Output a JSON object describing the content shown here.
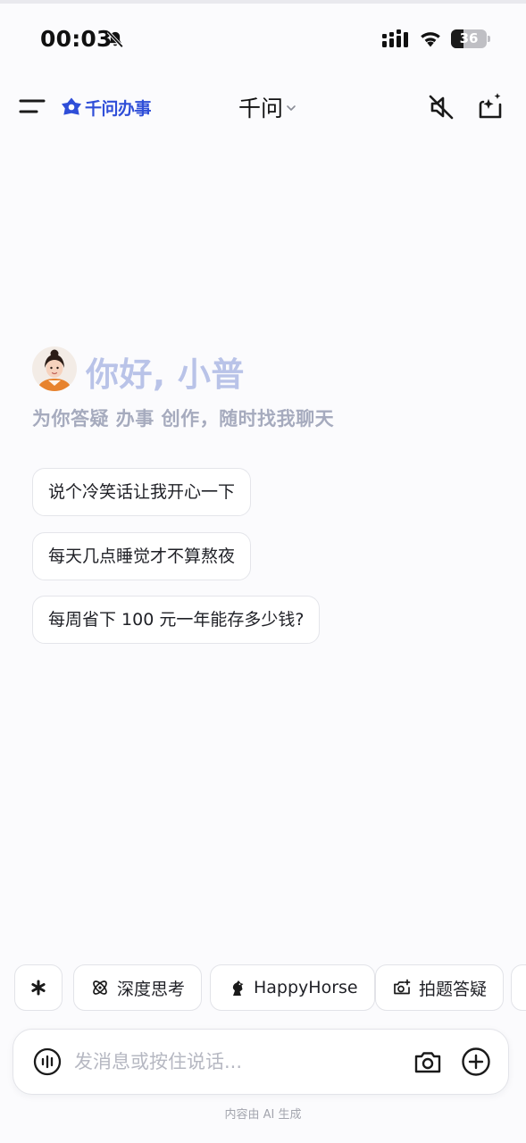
{
  "status_bar": {
    "time": "00:03",
    "battery_level": "36",
    "battery_fraction": 0.36,
    "icons": [
      "bell-slash-icon",
      "cellular-signal-icon",
      "wifi-icon",
      "battery-icon"
    ]
  },
  "header": {
    "brand_name": "千问办事",
    "model_name": "千问",
    "icons": [
      "menu-icon",
      "brand-logo-icon",
      "chevron-down-icon",
      "speaker-mute-icon",
      "new-chat-sparkle-icon"
    ],
    "brand_color": "#2f4ed8"
  },
  "greeting": {
    "title": "你好, 小普",
    "subtitle": "为你答疑 办事 创作，随时找我聊天",
    "title_color": "#b9c3e8"
  },
  "suggestions": [
    "说个冷笑话让我开心一下",
    "每天几点睡觉才不算熬夜",
    "每周省下 100 元一年能存多少钱?"
  ],
  "chips": {
    "more_icon": "asterisk-icon",
    "items": [
      {
        "label": "深度思考",
        "icon": "deep-think-icon"
      },
      {
        "label": "HappyHorse",
        "icon": "horse-icon"
      },
      {
        "label": "拍题答疑",
        "icon": "photo-question-icon"
      }
    ]
  },
  "composer": {
    "placeholder": "发消息或按住说话...",
    "icons": [
      "voice-wave-icon",
      "camera-icon",
      "plus-circle-icon"
    ]
  },
  "footer": {
    "note": "内容由 AI 生成"
  }
}
